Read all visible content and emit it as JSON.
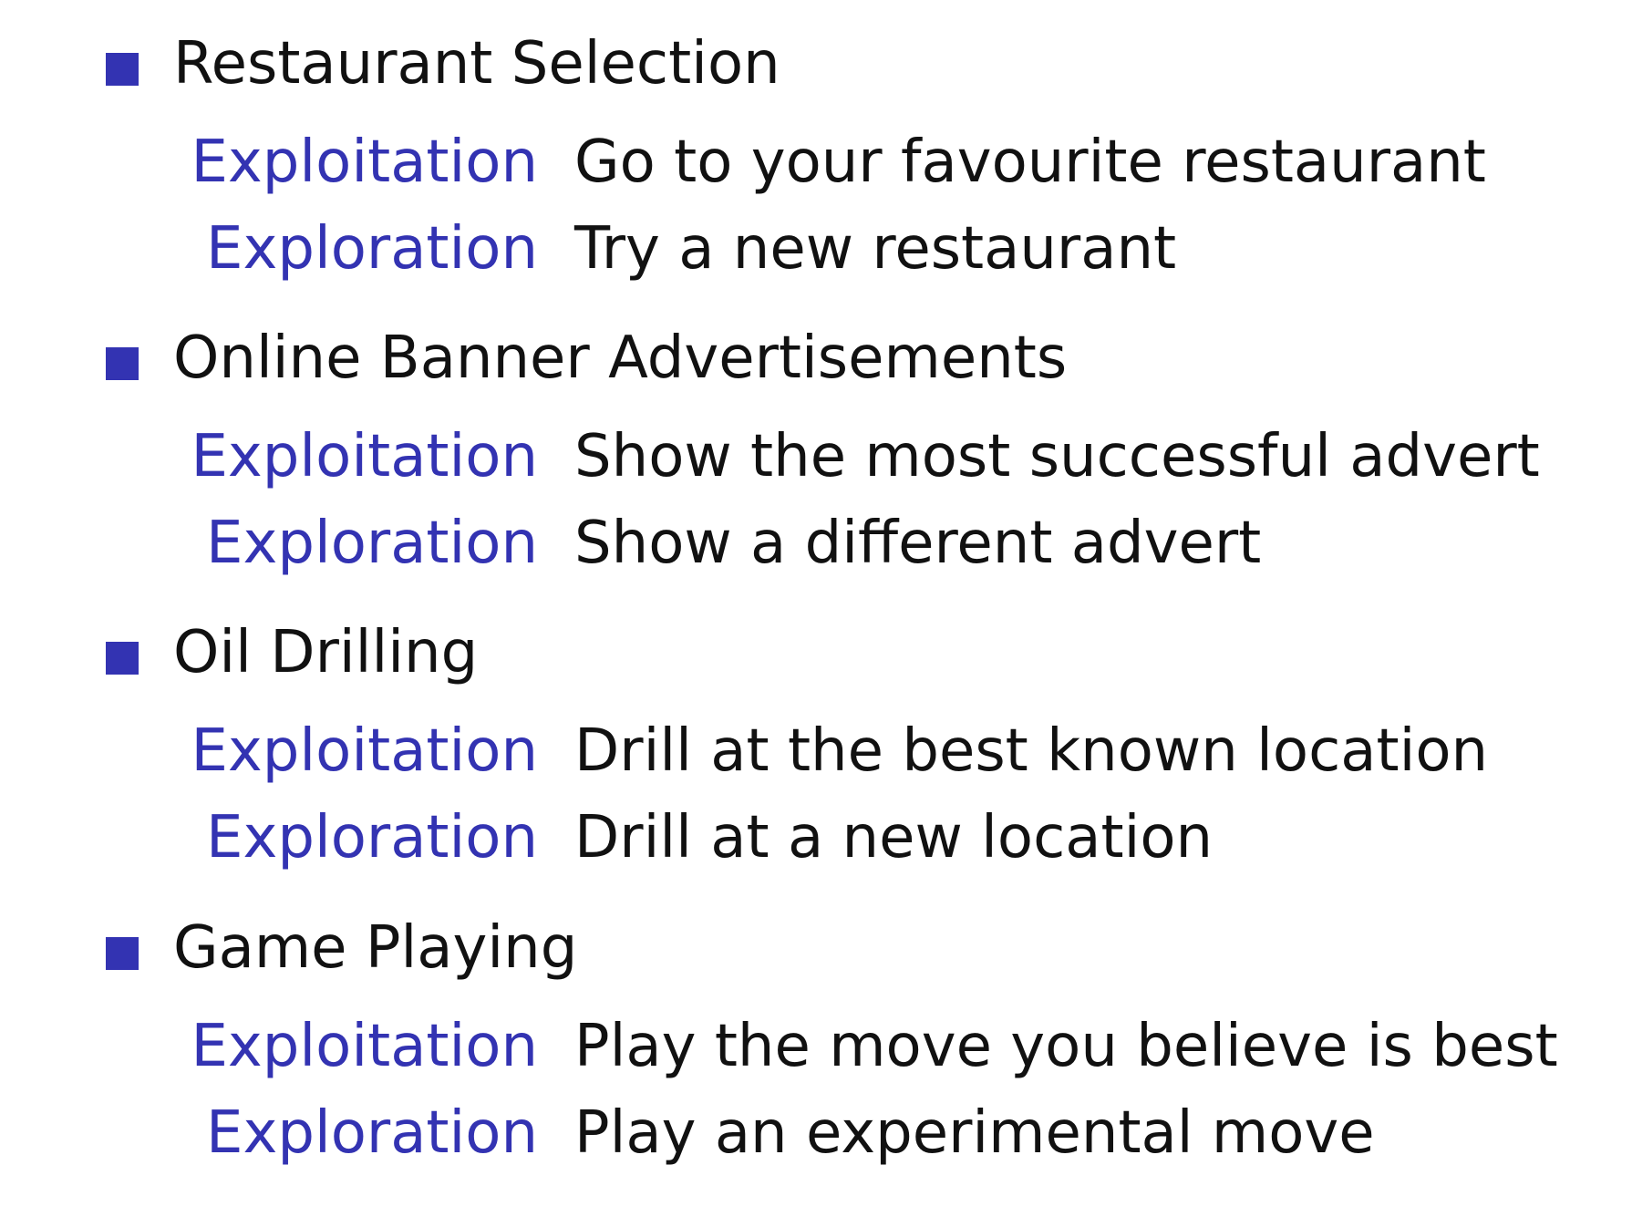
{
  "sections": [
    {
      "title": "Restaurant Selection",
      "rows": [
        {
          "term": "Exploitation",
          "desc": "Go to your favourite restaurant"
        },
        {
          "term": "Exploration",
          "desc": "Try a new restaurant"
        }
      ]
    },
    {
      "title": "Online Banner Advertisements",
      "rows": [
        {
          "term": "Exploitation",
          "desc": "Show the most successful advert"
        },
        {
          "term": "Exploration",
          "desc": "Show a different advert"
        }
      ]
    },
    {
      "title": "Oil Drilling",
      "rows": [
        {
          "term": "Exploitation",
          "desc": "Drill at the best known location"
        },
        {
          "term": "Exploration",
          "desc": "Drill at a new location"
        }
      ]
    },
    {
      "title": "Game Playing",
      "rows": [
        {
          "term": "Exploitation",
          "desc": "Play the move you believe is best"
        },
        {
          "term": "Exploration",
          "desc": "Play an experimental move"
        }
      ]
    }
  ],
  "colors": {
    "accent": "#3333b2",
    "text": "#111111"
  }
}
